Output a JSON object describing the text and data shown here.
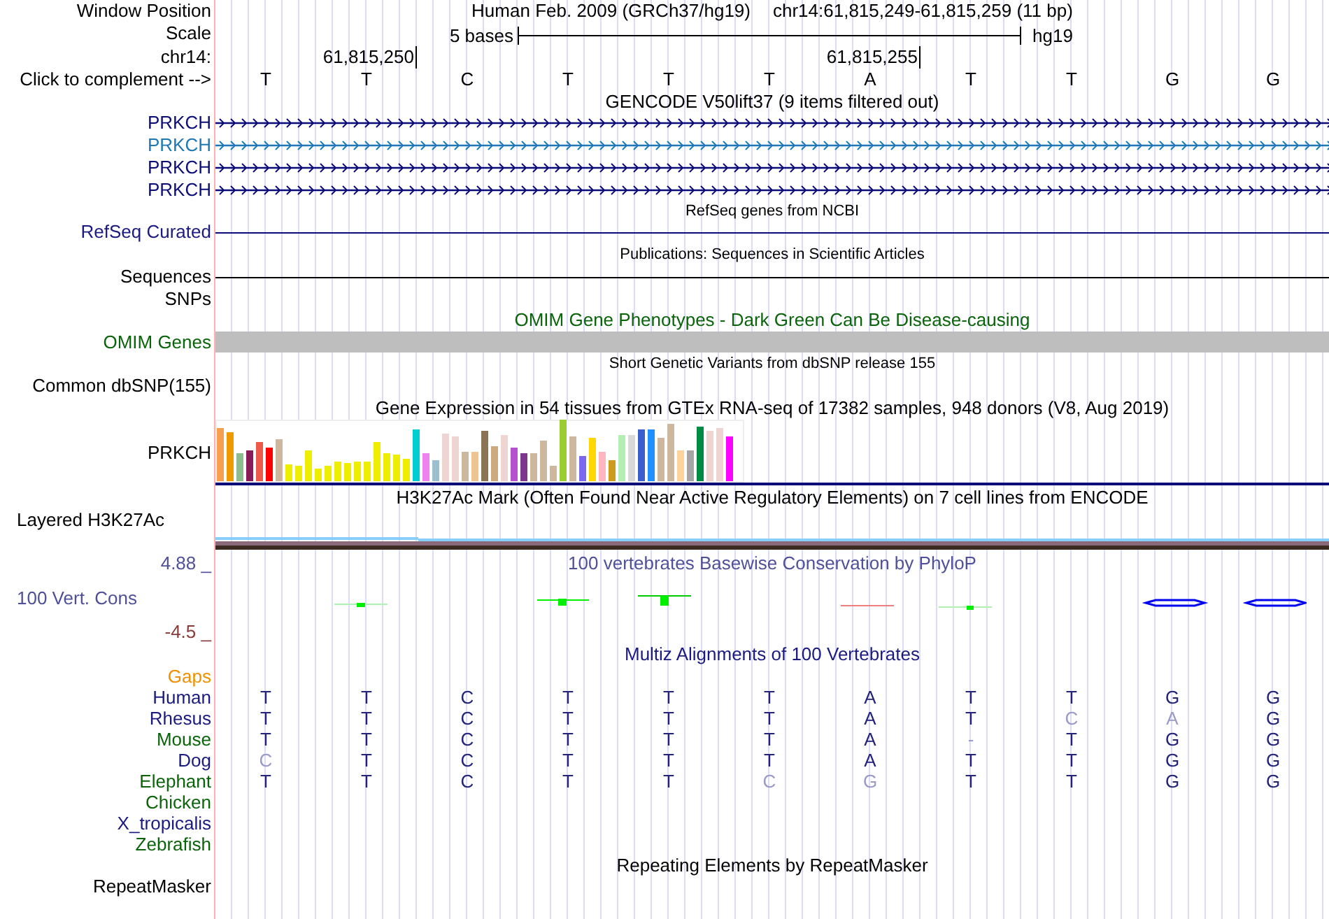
{
  "header": {
    "label": "Window Position",
    "assembly": "Human Feb. 2009 (GRCh37/hg19)",
    "position": "chr14:61,815,249-61,815,259 (11 bp)"
  },
  "scale": {
    "label": "Scale",
    "length": "5 bases",
    "assembly": "hg19"
  },
  "coordinates": {
    "label": "chr14:",
    "ticks": [
      "61,815,250",
      "61,815,255"
    ]
  },
  "complement": {
    "label": "Click to complement -->",
    "bases": [
      "T",
      "T",
      "C",
      "T",
      "T",
      "T",
      "A",
      "T",
      "T",
      "G",
      "G"
    ]
  },
  "gencode": {
    "title": "GENCODE V50lift37 (9 items filtered out)",
    "genes": [
      {
        "label": "PRKCH",
        "color": "#0c0c78"
      },
      {
        "label": "PRKCH",
        "color": "#1e78b4"
      },
      {
        "label": "PRKCH",
        "color": "#0c0c78"
      },
      {
        "label": "PRKCH",
        "color": "#0c0c78"
      }
    ]
  },
  "refseq": {
    "title": "RefSeq genes from NCBI",
    "label": "RefSeq Curated"
  },
  "publications": {
    "title": "Publications: Sequences in Scientific Articles",
    "label": "Sequences"
  },
  "snps": {
    "label": "SNPs"
  },
  "omim": {
    "title": "OMIM Gene Phenotypes - Dark Green Can Be Disease-causing",
    "label": "OMIM Genes"
  },
  "dbsnp": {
    "title": "Short Genetic Variants from dbSNP release 155",
    "label": "Common dbSNP(155)"
  },
  "gtex": {
    "title": "Gene Expression in 54 tissues from GTEx RNA-seq of 17382 samples, 948 donors (V8, Aug 2019)",
    "label": "PRKCH"
  },
  "h3k27ac": {
    "title": "H3K27Ac Mark (Often Found Near Active Regulatory Elements) on 7 cell lines from ENCODE",
    "label": "Layered H3K27Ac"
  },
  "phylop": {
    "title": "100 vertebrates Basewise Conservation by PhyloP",
    "max": "4.88 _",
    "label": "100 Vert. Cons",
    "min": "-4.5 _"
  },
  "multiz": {
    "title": "Multiz Alignments of 100 Vertebrates",
    "gaps_label": "Gaps",
    "species": [
      {
        "name": "Human",
        "color": "#1a1a80",
        "bases": [
          {
            "text": "T",
            "differs": false
          },
          {
            "text": "T",
            "differs": false
          },
          {
            "text": "C",
            "differs": false
          },
          {
            "text": "T",
            "differs": false
          },
          {
            "text": "T",
            "differs": false
          },
          {
            "text": "T",
            "differs": false
          },
          {
            "text": "A",
            "differs": false
          },
          {
            "text": "T",
            "differs": false
          },
          {
            "text": "T",
            "differs": false
          },
          {
            "text": "G",
            "differs": false
          },
          {
            "text": "G",
            "differs": false
          }
        ]
      },
      {
        "name": "Rhesus",
        "color": "#1a1a80",
        "bases": [
          {
            "text": "T",
            "differs": false
          },
          {
            "text": "T",
            "differs": false
          },
          {
            "text": "C",
            "differs": false
          },
          {
            "text": "T",
            "differs": false
          },
          {
            "text": "T",
            "differs": false
          },
          {
            "text": "T",
            "differs": false
          },
          {
            "text": "A",
            "differs": false
          },
          {
            "text": "T",
            "differs": false
          },
          {
            "text": "C",
            "differs": true
          },
          {
            "text": "A",
            "differs": true
          },
          {
            "text": "G",
            "differs": false
          }
        ]
      },
      {
        "name": "Mouse",
        "color": "#0a640a",
        "bases": [
          {
            "text": "T",
            "differs": false
          },
          {
            "text": "T",
            "differs": false
          },
          {
            "text": "C",
            "differs": false
          },
          {
            "text": "T",
            "differs": false
          },
          {
            "text": "T",
            "differs": false
          },
          {
            "text": "T",
            "differs": false
          },
          {
            "text": "A",
            "differs": false
          },
          {
            "text": "-",
            "differs": true
          },
          {
            "text": "T",
            "differs": false
          },
          {
            "text": "G",
            "differs": false
          },
          {
            "text": "G",
            "differs": false
          }
        ]
      },
      {
        "name": "Dog",
        "color": "#1a1a80",
        "bases": [
          {
            "text": "C",
            "differs": true
          },
          {
            "text": "T",
            "differs": false
          },
          {
            "text": "C",
            "differs": false
          },
          {
            "text": "T",
            "differs": false
          },
          {
            "text": "T",
            "differs": false
          },
          {
            "text": "T",
            "differs": false
          },
          {
            "text": "A",
            "differs": false
          },
          {
            "text": "T",
            "differs": false
          },
          {
            "text": "T",
            "differs": false
          },
          {
            "text": "G",
            "differs": false
          },
          {
            "text": "G",
            "differs": false
          }
        ]
      },
      {
        "name": "Elephant",
        "color": "#0a640a",
        "bases": [
          {
            "text": "T",
            "differs": false
          },
          {
            "text": "T",
            "differs": false
          },
          {
            "text": "C",
            "differs": false
          },
          {
            "text": "T",
            "differs": false
          },
          {
            "text": "T",
            "differs": false
          },
          {
            "text": "C",
            "differs": true
          },
          {
            "text": "G",
            "differs": true
          },
          {
            "text": "T",
            "differs": false
          },
          {
            "text": "T",
            "differs": false
          },
          {
            "text": "G",
            "differs": false
          },
          {
            "text": "G",
            "differs": false
          }
        ]
      },
      {
        "name": "Chicken",
        "color": "#0a640a"
      },
      {
        "name": "X_tropicalis",
        "color": "#1a1a80"
      },
      {
        "name": "Zebrafish",
        "color": "#0a640a"
      }
    ]
  },
  "repeatmasker": {
    "title": "Repeating Elements by RepeatMasker",
    "label": "RepeatMasker"
  }
}
